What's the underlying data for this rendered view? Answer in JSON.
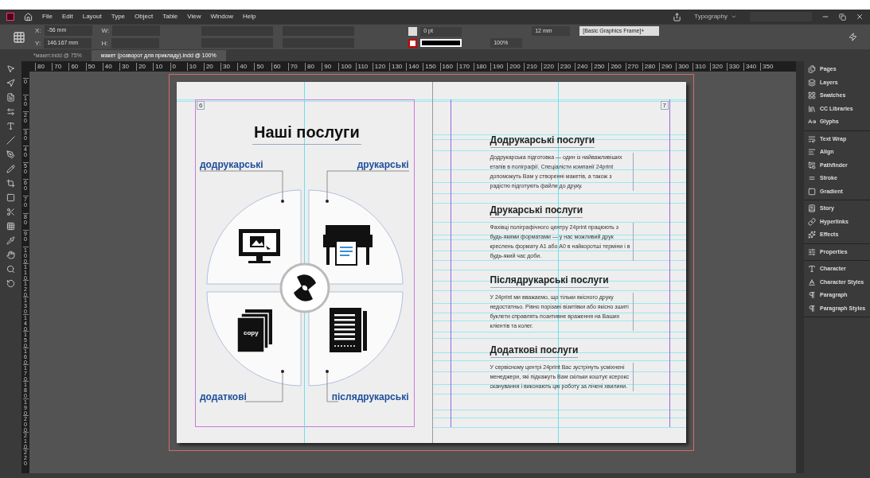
{
  "menu": {
    "items": [
      "File",
      "Edit",
      "Layout",
      "Type",
      "Object",
      "Table",
      "View",
      "Window",
      "Help"
    ],
    "workspace": "Typography"
  },
  "control_panel": {
    "x_label": "X:",
    "x_value": "-56 mm",
    "y_label": "Y:",
    "y_value": "146.167 mm",
    "w_label": "W:",
    "h_label": "H:",
    "stroke_weight": "0 pt",
    "opacity": "100%",
    "gap": "12 mm",
    "frame_style": "[Basic Graphics Frame]+"
  },
  "tabs": [
    {
      "label": "*макет.indd @ 75%",
      "selected": false
    },
    {
      "label": "макет (розворот для прикладу).indd @ 100%",
      "selected": true
    }
  ],
  "ruler": {
    "horizontal": [
      "80",
      "70",
      "60",
      "50",
      "40",
      "30",
      "20",
      "10",
      "0",
      "10",
      "20",
      "30",
      "40",
      "50",
      "60",
      "70",
      "80",
      "90",
      "100",
      "110",
      "120",
      "130",
      "140",
      "150",
      "160",
      "170",
      "180",
      "190",
      "200",
      "210",
      "220",
      "230",
      "240",
      "250",
      "260",
      "270",
      "280",
      "290",
      "300",
      "310",
      "320",
      "330",
      "340",
      "350"
    ],
    "vertical": [
      "0",
      "10",
      "20",
      "30",
      "40",
      "50",
      "60",
      "70",
      "80",
      "90",
      "100",
      "110",
      "120",
      "130",
      "140",
      "150",
      "160",
      "170",
      "180",
      "190",
      "200",
      "210",
      "220"
    ]
  },
  "left_page": {
    "number": "6",
    "title": "Наші послуги",
    "callouts": [
      "додрукарські",
      "друкарські",
      "додаткові",
      "післядрукарські"
    ],
    "copy_label": "copy"
  },
  "right_page": {
    "number": "7",
    "sections": [
      {
        "heading": "Додрукарські послуги",
        "body": "Додрукарська підготовка — один із найважливіших етапів в поліграфії. Спеціалісти компанії 24print допоможуть Вам у створенні макетів, а також з радістю підготують файли до друку."
      },
      {
        "heading": "Друкарські послуги",
        "body": "Фахівці поліграфічного центру 24print працюють з будь-якими форматами — у нас можливий друк креслень формату А1 або А0 в найкоротші терміни і в будь-який час доби."
      },
      {
        "heading": "Післядрукарські послуги",
        "body": "У 24print ми вважаємо, що тільки якісного друку недостатньо. Рівно порізані візитівки або якісно зшиті буклети справлять позитивне враження на Ваших клієнтів та колег."
      },
      {
        "heading": "Додаткові послуги",
        "body": "У сервісному центрі 24print Вас зустрінуть усміхнені менеджери, які підкажуть Вам скільки коштує ксерокс сканування і виконають цю роботу за лічені хвилини."
      }
    ]
  },
  "panels": [
    [
      "Pages",
      "Layers",
      "Swatches",
      "CC Libraries",
      "Glyphs"
    ],
    [
      "Text Wrap",
      "Align",
      "Pathfinder",
      "Stroke",
      "Gradient"
    ],
    [
      "Story",
      "Hyperlinks",
      "Effects"
    ],
    [
      "Properties"
    ],
    [
      "Character",
      "Character Styles",
      "Paragraph",
      "Paragraph Styles"
    ]
  ]
}
